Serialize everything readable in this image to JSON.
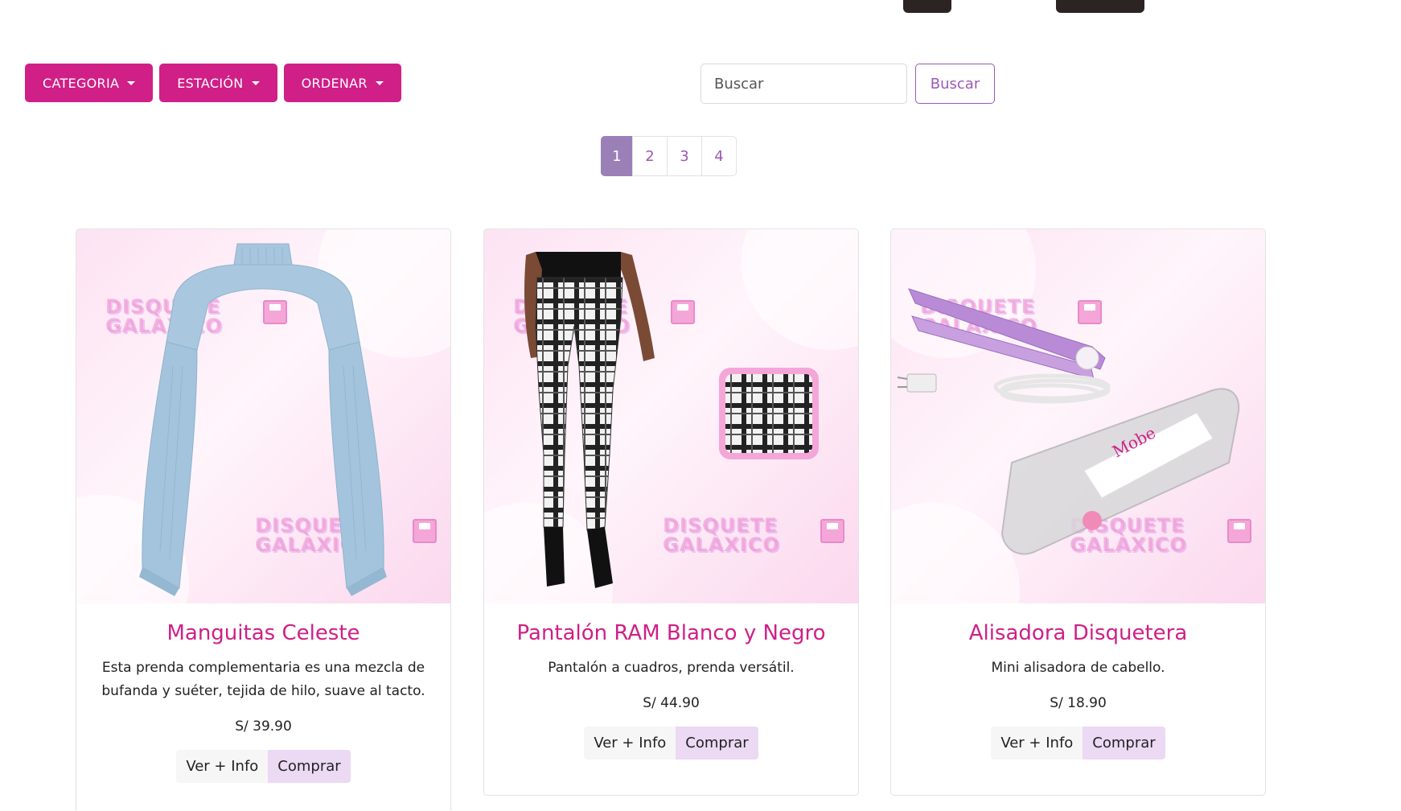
{
  "filters": {
    "categoria": "CATEGORIA",
    "estacion": "ESTACIÓN",
    "ordenar": "ORDENAR"
  },
  "search": {
    "placeholder": "Buscar",
    "button": "Buscar"
  },
  "pagination": {
    "pages": [
      "1",
      "2",
      "3",
      "4"
    ],
    "current": "1"
  },
  "watermark": {
    "line1": "DISQUETE",
    "line2": "GALAXICO"
  },
  "products": [
    {
      "name": "Manguitas Celeste",
      "description": "Esta prenda complementaria es una mezcla de bufanda y suéter, tejida de hilo, suave al tacto.",
      "price": "S/ 39.90",
      "info_label": "Ver + Info",
      "buy_label": "Comprar"
    },
    {
      "name": "Pantalón RAM Blanco y Negro",
      "description": "Pantalón a cuadros, prenda versátil.",
      "price": "S/ 44.90",
      "info_label": "Ver + Info",
      "buy_label": "Comprar"
    },
    {
      "name": "Alisadora Disquetera",
      "description": "Mini alisadora de cabello.",
      "price": "S/ 18.90",
      "info_label": "Ver + Info",
      "buy_label": "Comprar"
    }
  ],
  "colors": {
    "primary": "#d01f87",
    "accent": "#9b59b6",
    "active_page": "#9b80b8",
    "buy_button": "#ecd9f4"
  },
  "icons": {
    "dropdown": "caret-down-icon",
    "watermark_logo": "floppy-disk-icon"
  }
}
